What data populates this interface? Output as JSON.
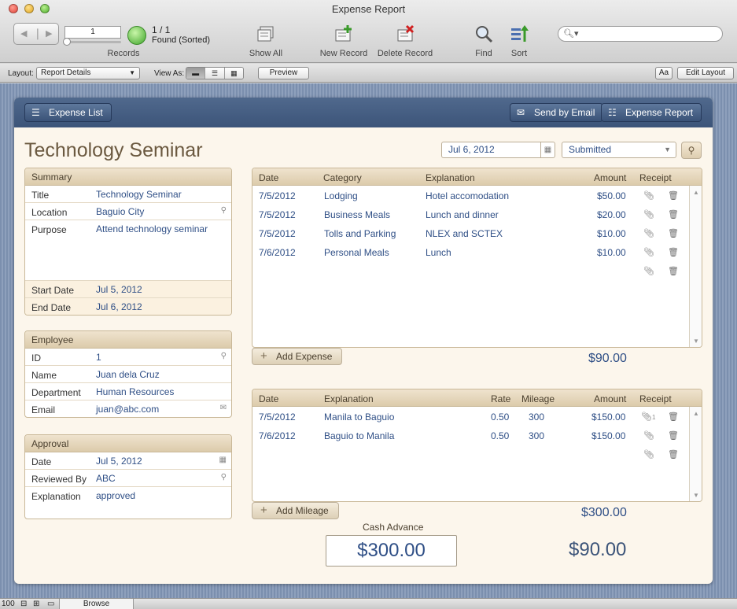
{
  "window": {
    "title": "Expense Report"
  },
  "toolbar": {
    "record_number": "1",
    "record_count": "1 / 1",
    "found_text": "Found (Sorted)",
    "records_label": "Records",
    "show_all_label": "Show All",
    "new_record_label": "New Record",
    "delete_record_label": "Delete Record",
    "find_label": "Find",
    "sort_label": "Sort",
    "search_placeholder": ""
  },
  "layoutbar": {
    "layout_label": "Layout:",
    "layout_value": "Report Details",
    "view_as_label": "View As:",
    "preview_label": "Preview",
    "text_format_label": "Aa",
    "edit_layout_label": "Edit Layout"
  },
  "header": {
    "expense_list_label": "Expense List",
    "send_email_label": "Send by Email",
    "expense_report_label": "Expense Report"
  },
  "report": {
    "title": "Technology Seminar",
    "date": "Jul 6, 2012",
    "status": "Submitted"
  },
  "summary": {
    "heading": "Summary",
    "title_label": "Title",
    "title_value": "Technology Seminar",
    "location_label": "Location",
    "location_value": "Baguio City",
    "purpose_label": "Purpose",
    "purpose_value": "Attend technology seminar",
    "start_label": "Start Date",
    "start_value": "Jul 5, 2012",
    "end_label": "End Date",
    "end_value": "Jul 6, 2012"
  },
  "employee": {
    "heading": "Employee",
    "id_label": "ID",
    "id_value": "1",
    "name_label": "Name",
    "name_value": "Juan dela Cruz",
    "dept_label": "Department",
    "dept_value": "Human Resources",
    "email_label": "Email",
    "email_value": "juan@abc.com"
  },
  "approval": {
    "heading": "Approval",
    "date_label": "Date",
    "date_value": "Jul 5, 2012",
    "reviewed_label": "Reviewed By",
    "reviewed_value": "ABC",
    "explanation_label": "Explanation",
    "explanation_value": "approved"
  },
  "expenses": {
    "headers": {
      "date": "Date",
      "category": "Category",
      "explanation": "Explanation",
      "amount": "Amount",
      "receipt": "Receipt"
    },
    "rows": [
      {
        "date": "7/5/2012",
        "category": "Lodging",
        "explanation": "Hotel accomodation",
        "amount": "$50.00"
      },
      {
        "date": "7/5/2012",
        "category": "Business Meals",
        "explanation": "Lunch and dinner",
        "amount": "$20.00"
      },
      {
        "date": "7/5/2012",
        "category": "Tolls and Parking",
        "explanation": "NLEX and SCTEX",
        "amount": "$10.00"
      },
      {
        "date": "7/6/2012",
        "category": "Personal Meals",
        "explanation": "Lunch",
        "amount": "$10.00"
      }
    ],
    "add_label": "Add Expense",
    "total": "$90.00"
  },
  "mileage": {
    "headers": {
      "date": "Date",
      "explanation": "Explanation",
      "rate": "Rate",
      "mileage": "Mileage",
      "amount": "Amount",
      "receipt": "Receipt"
    },
    "rows": [
      {
        "date": "7/5/2012",
        "explanation": "Manila to Baguio",
        "rate": "0.50",
        "mileage": "300",
        "amount": "$150.00",
        "receipt_count": "1"
      },
      {
        "date": "7/6/2012",
        "explanation": "Baguio to Manila",
        "rate": "0.50",
        "mileage": "300",
        "amount": "$150.00"
      }
    ],
    "add_label": "Add Mileage",
    "total": "$300.00"
  },
  "cash_advance": {
    "label": "Cash Advance",
    "value": "$300.00"
  },
  "grand_total": "$90.00",
  "statusbar": {
    "zoom": "100",
    "mode": "Browse"
  },
  "colors": {
    "accent": "#3c5479",
    "value_text": "#2f4f86",
    "panel_bg": "#fcf6ec",
    "header_bg": "#efe3ce"
  }
}
